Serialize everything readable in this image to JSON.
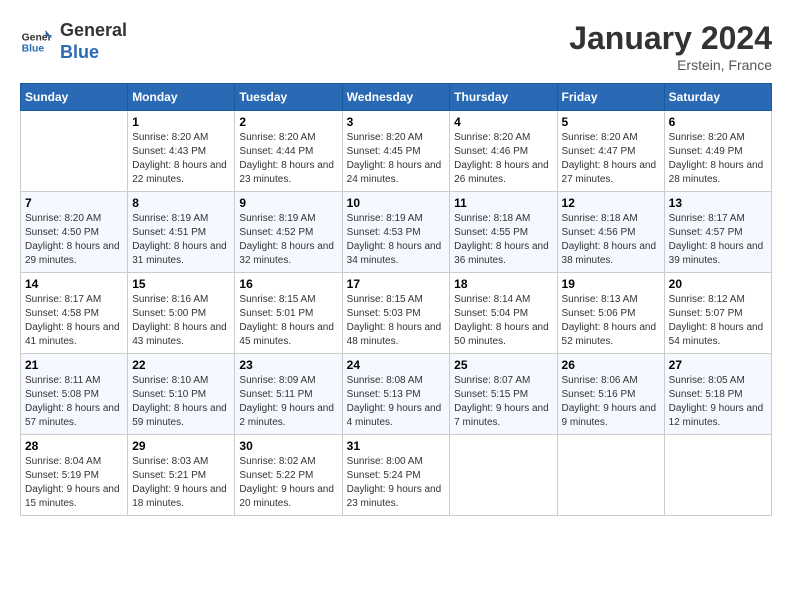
{
  "header": {
    "logo_text_general": "General",
    "logo_text_blue": "Blue",
    "month_title": "January 2024",
    "location": "Erstein, France"
  },
  "days_of_week": [
    "Sunday",
    "Monday",
    "Tuesday",
    "Wednesday",
    "Thursday",
    "Friday",
    "Saturday"
  ],
  "weeks": [
    [
      {
        "day": "",
        "sunrise": "",
        "sunset": "",
        "daylight": ""
      },
      {
        "day": "1",
        "sunrise": "Sunrise: 8:20 AM",
        "sunset": "Sunset: 4:43 PM",
        "daylight": "Daylight: 8 hours and 22 minutes."
      },
      {
        "day": "2",
        "sunrise": "Sunrise: 8:20 AM",
        "sunset": "Sunset: 4:44 PM",
        "daylight": "Daylight: 8 hours and 23 minutes."
      },
      {
        "day": "3",
        "sunrise": "Sunrise: 8:20 AM",
        "sunset": "Sunset: 4:45 PM",
        "daylight": "Daylight: 8 hours and 24 minutes."
      },
      {
        "day": "4",
        "sunrise": "Sunrise: 8:20 AM",
        "sunset": "Sunset: 4:46 PM",
        "daylight": "Daylight: 8 hours and 26 minutes."
      },
      {
        "day": "5",
        "sunrise": "Sunrise: 8:20 AM",
        "sunset": "Sunset: 4:47 PM",
        "daylight": "Daylight: 8 hours and 27 minutes."
      },
      {
        "day": "6",
        "sunrise": "Sunrise: 8:20 AM",
        "sunset": "Sunset: 4:49 PM",
        "daylight": "Daylight: 8 hours and 28 minutes."
      }
    ],
    [
      {
        "day": "7",
        "sunrise": "Sunrise: 8:20 AM",
        "sunset": "Sunset: 4:50 PM",
        "daylight": "Daylight: 8 hours and 29 minutes."
      },
      {
        "day": "8",
        "sunrise": "Sunrise: 8:19 AM",
        "sunset": "Sunset: 4:51 PM",
        "daylight": "Daylight: 8 hours and 31 minutes."
      },
      {
        "day": "9",
        "sunrise": "Sunrise: 8:19 AM",
        "sunset": "Sunset: 4:52 PM",
        "daylight": "Daylight: 8 hours and 32 minutes."
      },
      {
        "day": "10",
        "sunrise": "Sunrise: 8:19 AM",
        "sunset": "Sunset: 4:53 PM",
        "daylight": "Daylight: 8 hours and 34 minutes."
      },
      {
        "day": "11",
        "sunrise": "Sunrise: 8:18 AM",
        "sunset": "Sunset: 4:55 PM",
        "daylight": "Daylight: 8 hours and 36 minutes."
      },
      {
        "day": "12",
        "sunrise": "Sunrise: 8:18 AM",
        "sunset": "Sunset: 4:56 PM",
        "daylight": "Daylight: 8 hours and 38 minutes."
      },
      {
        "day": "13",
        "sunrise": "Sunrise: 8:17 AM",
        "sunset": "Sunset: 4:57 PM",
        "daylight": "Daylight: 8 hours and 39 minutes."
      }
    ],
    [
      {
        "day": "14",
        "sunrise": "Sunrise: 8:17 AM",
        "sunset": "Sunset: 4:58 PM",
        "daylight": "Daylight: 8 hours and 41 minutes."
      },
      {
        "day": "15",
        "sunrise": "Sunrise: 8:16 AM",
        "sunset": "Sunset: 5:00 PM",
        "daylight": "Daylight: 8 hours and 43 minutes."
      },
      {
        "day": "16",
        "sunrise": "Sunrise: 8:15 AM",
        "sunset": "Sunset: 5:01 PM",
        "daylight": "Daylight: 8 hours and 45 minutes."
      },
      {
        "day": "17",
        "sunrise": "Sunrise: 8:15 AM",
        "sunset": "Sunset: 5:03 PM",
        "daylight": "Daylight: 8 hours and 48 minutes."
      },
      {
        "day": "18",
        "sunrise": "Sunrise: 8:14 AM",
        "sunset": "Sunset: 5:04 PM",
        "daylight": "Daylight: 8 hours and 50 minutes."
      },
      {
        "day": "19",
        "sunrise": "Sunrise: 8:13 AM",
        "sunset": "Sunset: 5:06 PM",
        "daylight": "Daylight: 8 hours and 52 minutes."
      },
      {
        "day": "20",
        "sunrise": "Sunrise: 8:12 AM",
        "sunset": "Sunset: 5:07 PM",
        "daylight": "Daylight: 8 hours and 54 minutes."
      }
    ],
    [
      {
        "day": "21",
        "sunrise": "Sunrise: 8:11 AM",
        "sunset": "Sunset: 5:08 PM",
        "daylight": "Daylight: 8 hours and 57 minutes."
      },
      {
        "day": "22",
        "sunrise": "Sunrise: 8:10 AM",
        "sunset": "Sunset: 5:10 PM",
        "daylight": "Daylight: 8 hours and 59 minutes."
      },
      {
        "day": "23",
        "sunrise": "Sunrise: 8:09 AM",
        "sunset": "Sunset: 5:11 PM",
        "daylight": "Daylight: 9 hours and 2 minutes."
      },
      {
        "day": "24",
        "sunrise": "Sunrise: 8:08 AM",
        "sunset": "Sunset: 5:13 PM",
        "daylight": "Daylight: 9 hours and 4 minutes."
      },
      {
        "day": "25",
        "sunrise": "Sunrise: 8:07 AM",
        "sunset": "Sunset: 5:15 PM",
        "daylight": "Daylight: 9 hours and 7 minutes."
      },
      {
        "day": "26",
        "sunrise": "Sunrise: 8:06 AM",
        "sunset": "Sunset: 5:16 PM",
        "daylight": "Daylight: 9 hours and 9 minutes."
      },
      {
        "day": "27",
        "sunrise": "Sunrise: 8:05 AM",
        "sunset": "Sunset: 5:18 PM",
        "daylight": "Daylight: 9 hours and 12 minutes."
      }
    ],
    [
      {
        "day": "28",
        "sunrise": "Sunrise: 8:04 AM",
        "sunset": "Sunset: 5:19 PM",
        "daylight": "Daylight: 9 hours and 15 minutes."
      },
      {
        "day": "29",
        "sunrise": "Sunrise: 8:03 AM",
        "sunset": "Sunset: 5:21 PM",
        "daylight": "Daylight: 9 hours and 18 minutes."
      },
      {
        "day": "30",
        "sunrise": "Sunrise: 8:02 AM",
        "sunset": "Sunset: 5:22 PM",
        "daylight": "Daylight: 9 hours and 20 minutes."
      },
      {
        "day": "31",
        "sunrise": "Sunrise: 8:00 AM",
        "sunset": "Sunset: 5:24 PM",
        "daylight": "Daylight: 9 hours and 23 minutes."
      },
      {
        "day": "",
        "sunrise": "",
        "sunset": "",
        "daylight": ""
      },
      {
        "day": "",
        "sunrise": "",
        "sunset": "",
        "daylight": ""
      },
      {
        "day": "",
        "sunrise": "",
        "sunset": "",
        "daylight": ""
      }
    ]
  ]
}
